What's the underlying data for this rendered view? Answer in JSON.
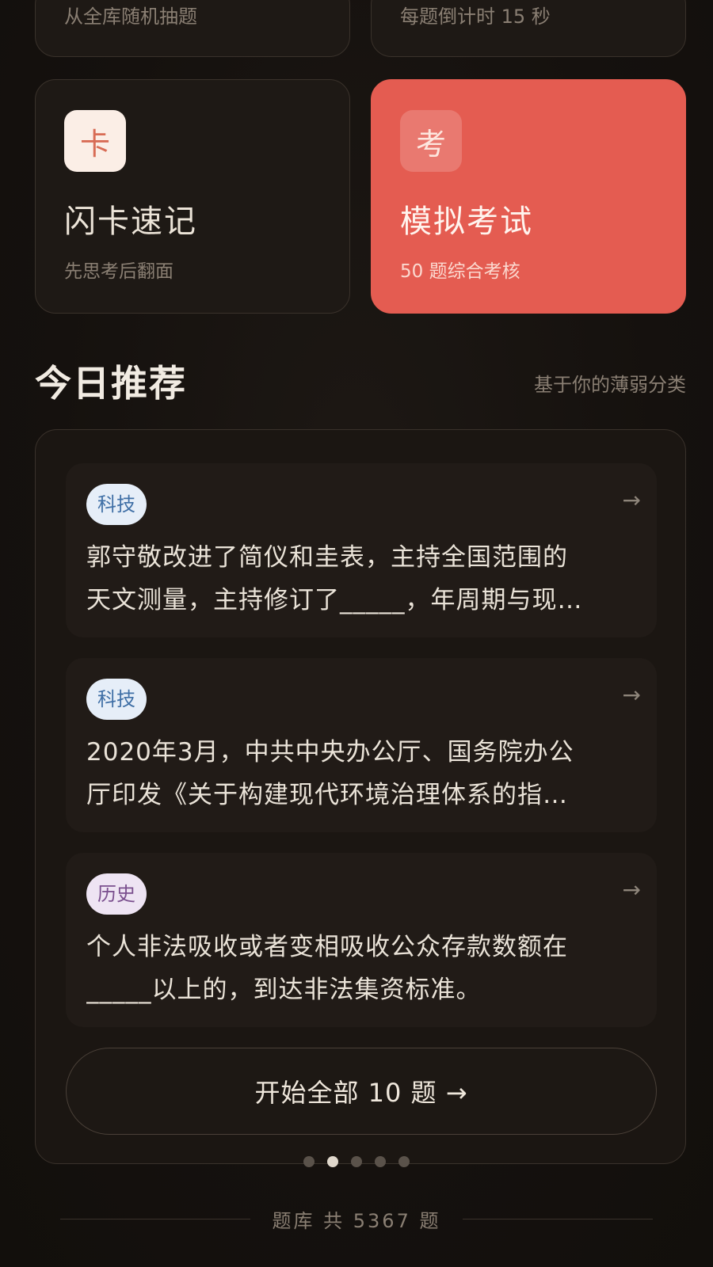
{
  "modes": {
    "random": {
      "subtitle": "从全库随机抽题"
    },
    "timed": {
      "subtitle": "每题倒计时 15 秒"
    },
    "flashcard": {
      "icon_char": "卡",
      "title": "闪卡速记",
      "subtitle": "先思考后翻面"
    },
    "mock_exam": {
      "icon_char": "考",
      "title": "模拟考试",
      "subtitle": "50 题综合考核",
      "accent": "#e45c51"
    }
  },
  "recommend": {
    "title": "今日推荐",
    "hint": "基于你的薄弱分类",
    "items": [
      {
        "tag": "科技",
        "lines": [
          "郭守敬改进了简仪和圭表，主持全国范围的",
          "天文测量，主持修订了_____，年周期与现…"
        ]
      },
      {
        "tag": "科技",
        "lines": [
          "2020年3月，中共中央办公厅、国务院办公",
          "厅印发《关于构建现代环境治理体系的指…"
        ]
      },
      {
        "tag": "历史",
        "lines": [
          "个人非法吸收或者变相吸收公众存款数额在",
          "_____以上的，到达非法集资标准。"
        ]
      }
    ],
    "arrow": "→",
    "start_button": "开始全部 10 题 →"
  },
  "pager": {
    "count": 5,
    "active_index": 1
  },
  "footer": {
    "text": "题库 共 5367 题"
  }
}
